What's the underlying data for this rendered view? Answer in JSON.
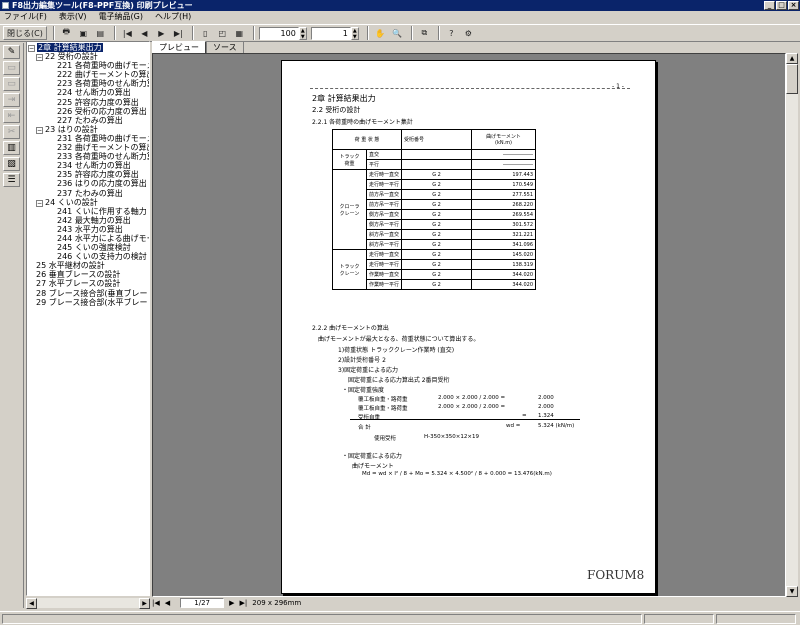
{
  "window": {
    "title": "F8出力編集ツール(F8-PPF互換) 印刷プレビュー",
    "min_btn": "_",
    "max_btn": "□",
    "close_btn": "×"
  },
  "menu": [
    "ファイル(F)",
    "表示(V)",
    "電子納品(G)",
    "ヘルプ(H)"
  ],
  "toolbar": {
    "close_label": "閉じる(C)",
    "zoom_value": "100",
    "page_value": "1"
  },
  "tree": [
    {
      "label": "2章 計算結果出力",
      "level": 0,
      "expander": "−",
      "selected": true
    },
    {
      "label": "22 受桁の設計",
      "level": 1,
      "expander": "−"
    },
    {
      "label": "221 各荷重時の曲げモーメ",
      "level": 2
    },
    {
      "label": "222 曲げモーメントの算出",
      "level": 2
    },
    {
      "label": "223 各荷重時のせん断力算",
      "level": 2
    },
    {
      "label": "224 せん断力の算出",
      "level": 2
    },
    {
      "label": "225 許容応力度の算出",
      "level": 2
    },
    {
      "label": "226 受桁の応力度の算出",
      "level": 2
    },
    {
      "label": "227 たわみの算出",
      "level": 2
    },
    {
      "label": "23 はりの設計",
      "level": 1,
      "expander": "−"
    },
    {
      "label": "231 各荷重時の曲げモーメ",
      "level": 2
    },
    {
      "label": "232 曲げモーメントの算出",
      "level": 2
    },
    {
      "label": "233 各荷重時のせん断力算",
      "level": 2
    },
    {
      "label": "234 せん断力の算出",
      "level": 2
    },
    {
      "label": "235 許容応力度の算出",
      "level": 2
    },
    {
      "label": "236 はりの応力度の算出",
      "level": 2
    },
    {
      "label": "237 たわみの算出",
      "level": 2
    },
    {
      "label": "24 くいの設計",
      "level": 1,
      "expander": "−"
    },
    {
      "label": "241 くいに作用する軸力",
      "level": 2
    },
    {
      "label": "242 最大軸力の算出",
      "level": 2
    },
    {
      "label": "243 水平力の算出",
      "level": 2
    },
    {
      "label": "244 水平力による曲げモー",
      "level": 2
    },
    {
      "label": "245 くいの強度検討",
      "level": 2
    },
    {
      "label": "246 くいの支持力の検討",
      "level": 2
    },
    {
      "label": "25 水平継材の設計",
      "level": 1
    },
    {
      "label": "26 垂直ブレースの設計",
      "level": 1
    },
    {
      "label": "27 水平ブレースの設計",
      "level": 1
    },
    {
      "label": "28 ブレース接合部(垂直ブレー",
      "level": 1
    },
    {
      "label": "29 ブレース接合部(水平ブレー",
      "level": 1
    }
  ],
  "tabs": [
    "プレビュー",
    "ソース"
  ],
  "document": {
    "page_no": "- 1 -",
    "h1": "2章  計算結果出力",
    "h2": "2.2  受桁の設計",
    "h3": "2.2.1  各荷重時の曲げモーメント集計",
    "load_table": {
      "col_load": "荷    重    状    態",
      "col_member": "受桁番号",
      "col_moment": "曲げモーメント",
      "col_unit": "(kN.m)",
      "groups": [
        {
          "name": "トラック\n荷重",
          "rows": [
            {
              "case": "直交",
              "member": "",
              "moment": "――――――"
            },
            {
              "case": "平行",
              "member": "",
              "moment": "――――――"
            }
          ]
        },
        {
          "name": "クローラ\nクレーン",
          "rows": [
            {
              "case": "走行時一直交",
              "member": "G 2",
              "moment": "197.443"
            },
            {
              "case": "走行時一平行",
              "member": "G 2",
              "moment": "170.549"
            },
            {
              "case": "前方吊一直交",
              "member": "G 2",
              "moment": "277.551"
            },
            {
              "case": "前方吊一平行",
              "member": "G 2",
              "moment": "268.220"
            },
            {
              "case": "側方吊一直交",
              "member": "G 2",
              "moment": "269.554"
            },
            {
              "case": "側方吊一平行",
              "member": "G 2",
              "moment": "301.572"
            },
            {
              "case": "斜方吊一直交",
              "member": "G 2",
              "moment": "321.221"
            },
            {
              "case": "斜方吊一平行",
              "member": "G 2",
              "moment": "341.096"
            }
          ]
        },
        {
          "name": "トラック\nクレーン",
          "rows": [
            {
              "case": "走行時一直交",
              "member": "G 2",
              "moment": "145.020"
            },
            {
              "case": "走行時一平行",
              "member": "G 2",
              "moment": "138.319"
            },
            {
              "case": "作業時一直交",
              "member": "G 2",
              "moment": "344.020"
            },
            {
              "case": "作業時一平行",
              "member": "G 2",
              "moment": "344.020"
            }
          ]
        }
      ]
    },
    "h3b": "2.2.2  曲げモーメントの算出",
    "para1": "曲げモーメントが最大となる、荷重状態について算出する。",
    "item1": "1)荷重状態      トラッククレーン作業時 (直交)",
    "item2": "2)設計受桁番号      2",
    "item3": "3)固定荷重による応力",
    "item3a": "固定荷重による応力算出式      2番目受桁",
    "sub1": "・固定荷重強度",
    "calc_rows": [
      {
        "label": "覆工板自重・路荷重",
        "expr": "2.000  ×   2.000 /  2.000 =",
        "value": "2.000"
      },
      {
        "label": "覆工板自重・路荷重",
        "expr": "2.000  ×   2.000 /  2.000 =",
        "value": "2.000"
      },
      {
        "label": "受桁自重",
        "expr": "=",
        "value": "1.324"
      }
    ],
    "sum_label": "合    計",
    "sum_symbol": "wd  =",
    "sum_value": "5.324 (kN/m)",
    "used_label": "使用受桁",
    "used_value": "H-350×350×12×19",
    "sub2": "・固定荷重による応力",
    "sub2a": "曲げモーメント",
    "formula": "Md = wd × l² / 8 + Mo =  5.324 ×   4.500² / 8 + 0.000 = 13.476(kN.m)",
    "brand": "FORUM8"
  },
  "status": {
    "page": "1/27",
    "size": "209 x 296mm"
  }
}
